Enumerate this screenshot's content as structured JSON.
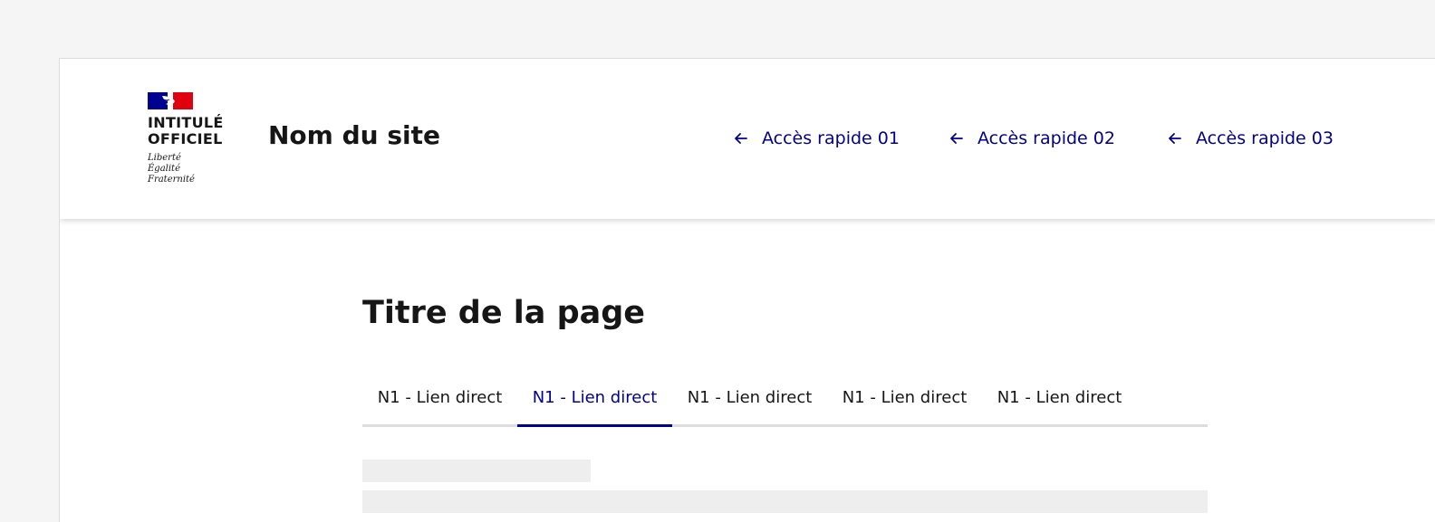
{
  "header": {
    "logo": {
      "line1": "INTITULÉ",
      "line2": "OFFICIEL",
      "motto": [
        "Liberté",
        "Égalité",
        "Fraternité"
      ]
    },
    "site_name": "Nom du site",
    "quick_links": [
      {
        "label": "Accès rapide 01",
        "icon": "arrow-left-icon"
      },
      {
        "label": "Accès rapide 02",
        "icon": "arrow-left-icon"
      },
      {
        "label": "Accès rapide 03",
        "icon": "arrow-left-icon"
      }
    ]
  },
  "main": {
    "page_title": "Titre de la page",
    "tabs": [
      {
        "label": "N1 - Lien direct",
        "active": false
      },
      {
        "label": "N1 - Lien direct",
        "active": true
      },
      {
        "label": "N1 - Lien direct",
        "active": false
      },
      {
        "label": "N1 - Lien direct",
        "active": false
      },
      {
        "label": "N1 - Lien direct",
        "active": false
      }
    ]
  },
  "colors": {
    "accent": "#000091",
    "flag_blue": "#000091",
    "flag_red": "#e1000f",
    "text": "#161616",
    "skeleton": "#eeeeee",
    "page_background": "#f5f5f5"
  }
}
